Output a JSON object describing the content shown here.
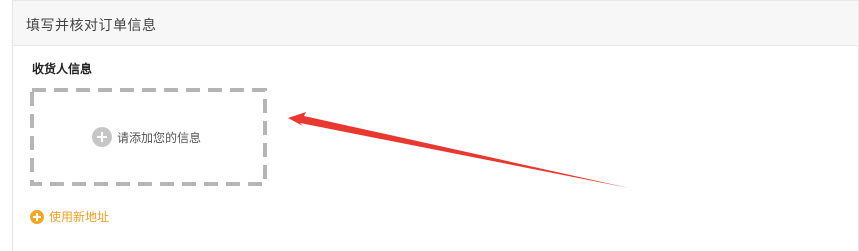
{
  "panel": {
    "title": "填写并核对订单信息"
  },
  "receiver": {
    "section_label": "收货人信息",
    "add_info_label": "请添加您的信息",
    "add_icon": "plus-circle-icon",
    "new_address_label": "使用新地址",
    "new_address_icon": "orange-plus-circle-icon"
  },
  "colors": {
    "accent": "#f0a020",
    "annotation_arrow": "#e8382f",
    "card_border": "#b5b5b5"
  }
}
